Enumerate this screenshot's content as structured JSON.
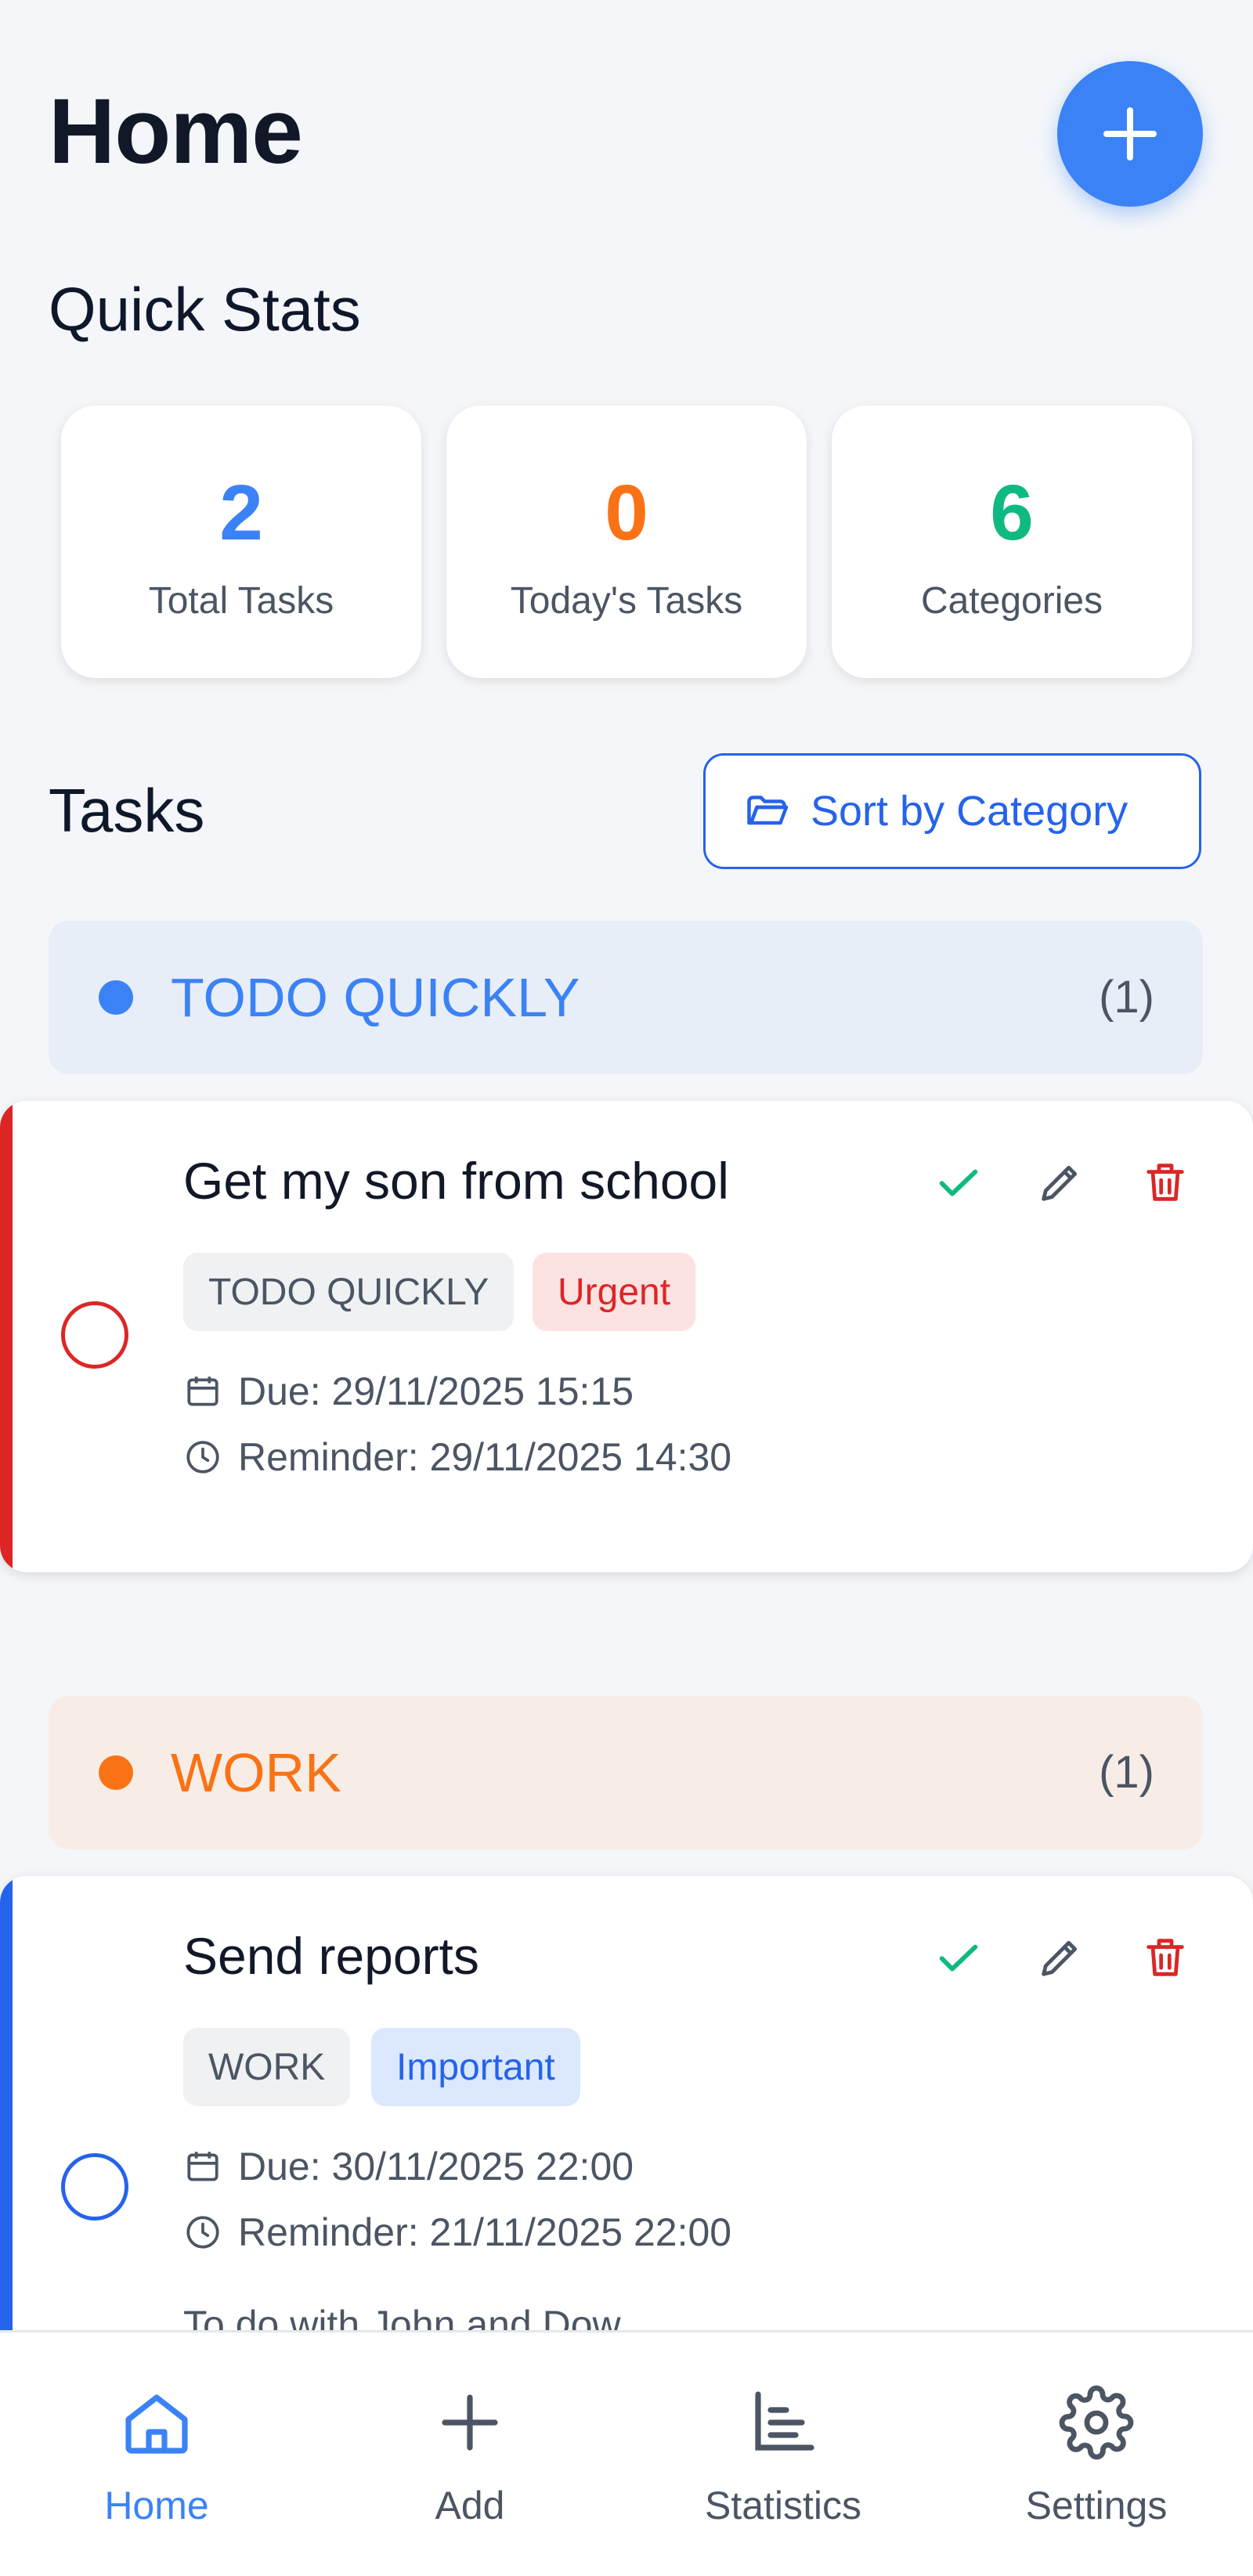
{
  "page_title": "Home",
  "add_fab_label": "+",
  "quick_stats": {
    "heading": "Quick Stats",
    "cards": [
      {
        "value": "2",
        "label": "Total Tasks",
        "color": "#3b82f6"
      },
      {
        "value": "0",
        "label": "Today's Tasks",
        "color": "#f97316"
      },
      {
        "value": "6",
        "label": "Categories",
        "color": "#10b981"
      }
    ]
  },
  "tasks_section": {
    "heading": "Tasks",
    "sort_button_label": "Sort by Category",
    "groups": [
      {
        "category": "TODO QUICKLY",
        "count": "(1)",
        "color": "#3b82f6",
        "header_bg": "#e8eef8",
        "tasks": [
          {
            "title": "Get my son from school",
            "category_tag": "TODO QUICKLY",
            "priority_tag": "Urgent",
            "priority_color": "#dc2626",
            "priority_bg": "#fde2e2",
            "accent": "#dc2626",
            "due": "Due: 29/11/2025 15:15",
            "reminder": "Reminder: 29/11/2025 14:30"
          }
        ]
      },
      {
        "category": "WORK",
        "count": "(1)",
        "color": "#f97316",
        "header_bg": "#f8ede6",
        "tasks": [
          {
            "title": "Send reports",
            "category_tag": "WORK",
            "priority_tag": "Important",
            "priority_color": "#2563eb",
            "priority_bg": "#dbe8fd",
            "accent": "#2563eb",
            "due": "Due: 30/11/2025 22:00",
            "reminder": "Reminder: 21/11/2025 22:00",
            "description": "To do with John and Dow"
          }
        ]
      }
    ]
  },
  "bottom_nav": [
    {
      "label": "Home",
      "icon": "home-icon",
      "active": true
    },
    {
      "label": "Add",
      "icon": "plus-icon",
      "active": false
    },
    {
      "label": "Statistics",
      "icon": "bar-chart-icon",
      "active": false
    },
    {
      "label": "Settings",
      "icon": "gear-icon",
      "active": false
    }
  ],
  "colors": {
    "primary": "#3b82f6",
    "nav_inactive": "#4b5563",
    "complete": "#10b981",
    "delete": "#dc2626"
  }
}
